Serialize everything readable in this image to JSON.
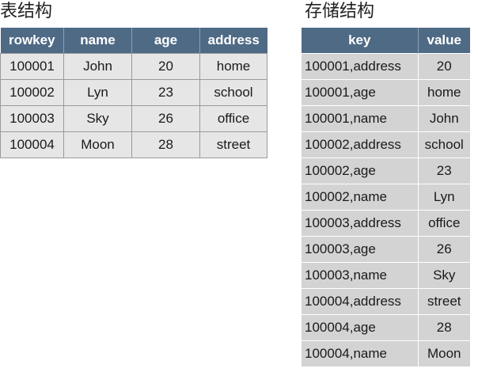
{
  "left": {
    "title": "表结构",
    "headers": [
      "rowkey",
      "name",
      "age",
      "address"
    ],
    "rows": [
      [
        "100001",
        "John",
        "20",
        "home"
      ],
      [
        "100002",
        "Lyn",
        "23",
        "school"
      ],
      [
        "100003",
        "Sky",
        "26",
        "office"
      ],
      [
        "100004",
        "Moon",
        "28",
        "street"
      ]
    ]
  },
  "right": {
    "title": "存储结构",
    "headers": [
      "key",
      "value"
    ],
    "rows": [
      [
        "100001,address",
        "20"
      ],
      [
        "100001,age",
        "home"
      ],
      [
        "100001,name",
        "John"
      ],
      [
        "100002,address",
        "school"
      ],
      [
        "100002,age",
        "23"
      ],
      [
        "100002,name",
        "Lyn"
      ],
      [
        "100003,address",
        "office"
      ],
      [
        "100003,age",
        "26"
      ],
      [
        "100003,name",
        "Sky"
      ],
      [
        "100004,address",
        "street"
      ],
      [
        "100004,age",
        "28"
      ],
      [
        "100004,name",
        "Moon"
      ]
    ]
  },
  "colors": {
    "header_bg": "#4f6a85",
    "left_cell_bg": "#e6e6e6",
    "right_cell_bg": "#d3d3d3"
  }
}
